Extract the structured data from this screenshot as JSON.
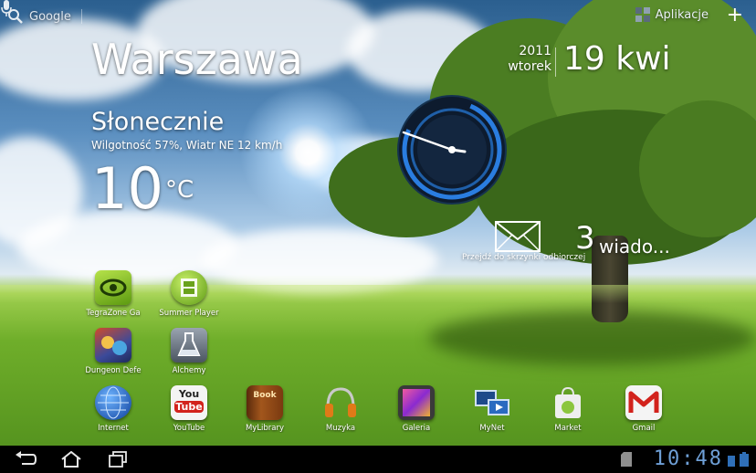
{
  "search": {
    "label": "Google"
  },
  "top_right": {
    "apps_label": "Aplikacje"
  },
  "weather": {
    "city": "Warszawa",
    "condition": "Słonecznie",
    "detail": "Wilgotność 57%, Wiatr NE 12 km/h",
    "temperature": "10",
    "unit": "°C"
  },
  "date": {
    "year": "2011",
    "weekday": "wtorek",
    "day_month": "19 kwi"
  },
  "mail": {
    "label": "Przejdź do skrzynki odbiorczej",
    "count": "3",
    "word": "wiado..."
  },
  "apps": [
    {
      "label": "TegraZone Ga",
      "icon": "tegrazone-icon"
    },
    {
      "label": "Summer Player",
      "icon": "summer-player-icon"
    },
    {
      "label": "Dungeon Defe",
      "icon": "dungeon-defenders-icon"
    },
    {
      "label": "Alchemy",
      "icon": "alchemy-flask-icon"
    },
    {
      "label": "Internet",
      "icon": "globe-icon"
    },
    {
      "label": "YouTube",
      "icon": "youtube-icon"
    },
    {
      "label": "MyLibrary",
      "icon": "book-icon"
    },
    {
      "label": "Muzyka",
      "icon": "headphones-icon"
    },
    {
      "label": "Galeria",
      "icon": "gallery-icon"
    },
    {
      "label": "MyNet",
      "icon": "mynet-icon"
    },
    {
      "label": "Market",
      "icon": "market-bag-icon"
    },
    {
      "label": "Gmail",
      "icon": "gmail-icon"
    }
  ],
  "youtube_logo": {
    "you": "You",
    "tube": "Tube"
  },
  "book_logo": "Book",
  "status": {
    "time": "10:48"
  },
  "colors": {
    "clock_accent": "#2a7de0",
    "status_time": "#6e9fd6"
  }
}
